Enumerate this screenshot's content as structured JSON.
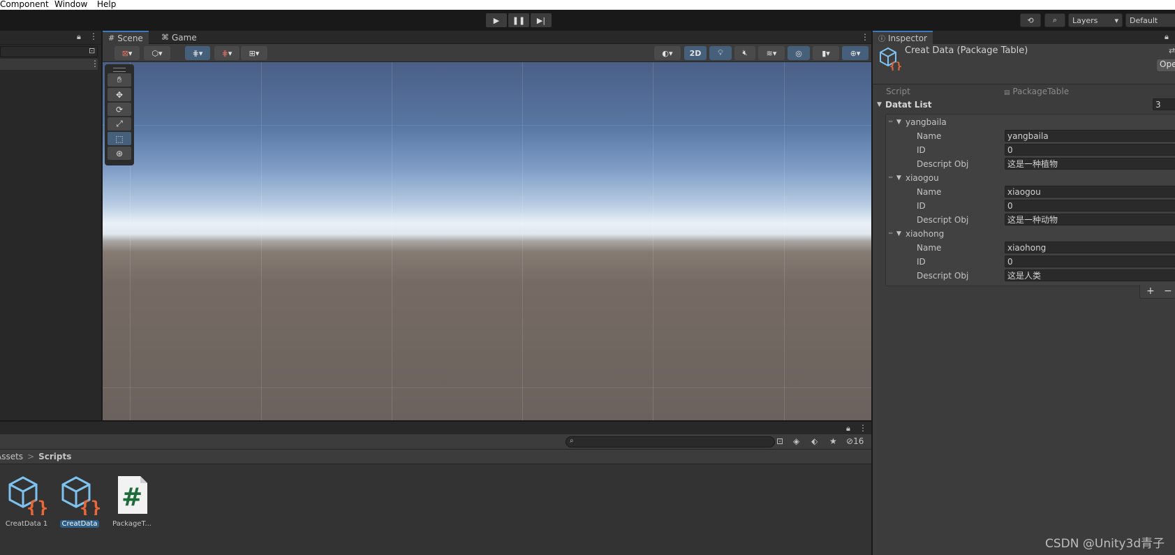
{
  "menu": {
    "items": [
      "Component",
      "Window",
      "Help"
    ]
  },
  "toolbar": {
    "layers_label": "Layers",
    "layout_label": "Default"
  },
  "scene": {
    "tabs": [
      "Scene",
      "Game"
    ],
    "toggle_2d": "2D"
  },
  "project": {
    "breadcrumb_root": "Assets",
    "breadcrumb_sep": ">",
    "breadcrumb_folder": "Scripts",
    "hidden_count": "16",
    "assets": [
      {
        "label": "CreatData 1",
        "type": "scriptable-object"
      },
      {
        "label": "CreatData",
        "type": "scriptable-object",
        "selected": true
      },
      {
        "label": "PackageT...",
        "type": "csharp-script"
      }
    ]
  },
  "inspector": {
    "tab": "Inspector",
    "object_title": "Creat Data (Package Table)",
    "open_button": "Ope",
    "script_label": "Script",
    "script_value": "PackageTable",
    "list_label": "Datat List",
    "list_count": "3",
    "name_label": "Name",
    "id_label": "ID",
    "descript_label": "Descript Obj",
    "items": [
      {
        "title": "yangbaila",
        "name": "yangbaila",
        "id": "0",
        "descript": "这是一种植物"
      },
      {
        "title": "xiaogou",
        "name": "xiaogou",
        "id": "0",
        "descript": "这是一种动物"
      },
      {
        "title": "xiaohong",
        "name": "xiaohong",
        "id": "0",
        "descript": "这是人类"
      }
    ],
    "add_button": "+",
    "remove_button": "−"
  },
  "watermark": "CSDN @Unity3d青子",
  "colors": {
    "accent": "#3a79bb",
    "selected": "#2c5d87",
    "panel": "#3c3c3c"
  }
}
